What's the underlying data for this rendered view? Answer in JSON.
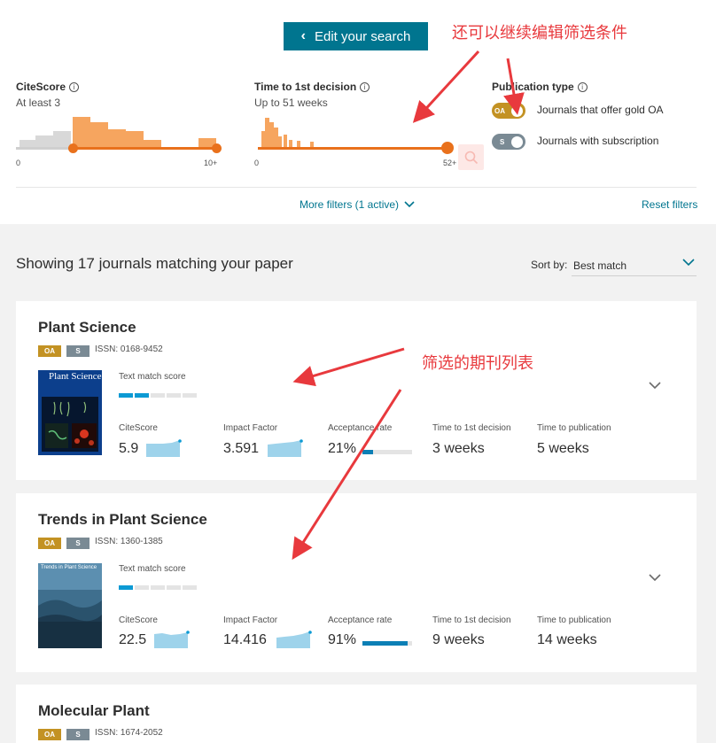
{
  "edit_button": {
    "label": "Edit your search"
  },
  "filters": {
    "citescore": {
      "title": "CiteScore",
      "value": "At least 3",
      "min": "0",
      "max": "10+"
    },
    "decision": {
      "title": "Time to 1st decision",
      "value": "Up to 51 weeks",
      "min": "0",
      "max": "52+"
    },
    "pubtype": {
      "title": "Publication type",
      "options": [
        {
          "badge": "OA",
          "label": "Journals that offer gold OA",
          "on": true
        },
        {
          "badge": "S",
          "label": "Journals with subscription",
          "on": false
        }
      ]
    },
    "more": "More filters (1 active)",
    "reset": "Reset filters"
  },
  "results": {
    "showing": "Showing 17 journals matching your paper",
    "sort_label": "Sort by:",
    "sort_value": "Best match"
  },
  "metric_labels": {
    "tms": "Text match score",
    "citescore": "CiteScore",
    "impact": "Impact Factor",
    "acceptance": "Acceptance rate",
    "decision": "Time to 1st decision",
    "publication": "Time to publication"
  },
  "journals": [
    {
      "title": "Plant Science",
      "oa": "OA",
      "s": "S",
      "issn": "ISSN: 0168-9452",
      "cover_title": "Plant Science",
      "text_match": 2,
      "citescore": "5.9",
      "impact": "3.591",
      "acceptance": "21%",
      "acceptance_value": 0.21,
      "decision": "3 weeks",
      "publication": "5 weeks"
    },
    {
      "title": "Trends in Plant Science",
      "oa": "OA",
      "s": "S",
      "issn": "ISSN: 1360-1385",
      "cover_title": "Trends in Plant Science",
      "text_match": 1,
      "citescore": "22.5",
      "impact": "14.416",
      "acceptance": "91%",
      "acceptance_value": 0.91,
      "decision": "9 weeks",
      "publication": "14 weeks"
    },
    {
      "title": "Molecular Plant",
      "oa": "OA",
      "s": "S",
      "issn": "ISSN: 1674-2052"
    }
  ],
  "annotations": {
    "top": "还可以继续编辑筛选条件",
    "list": "筛选的期刊列表"
  },
  "colors": {
    "accent": "#00758f",
    "orange": "#e9711c",
    "oa_badge": "#c39223",
    "s_badge": "#7a8a94",
    "annotation": "#e8393d"
  }
}
